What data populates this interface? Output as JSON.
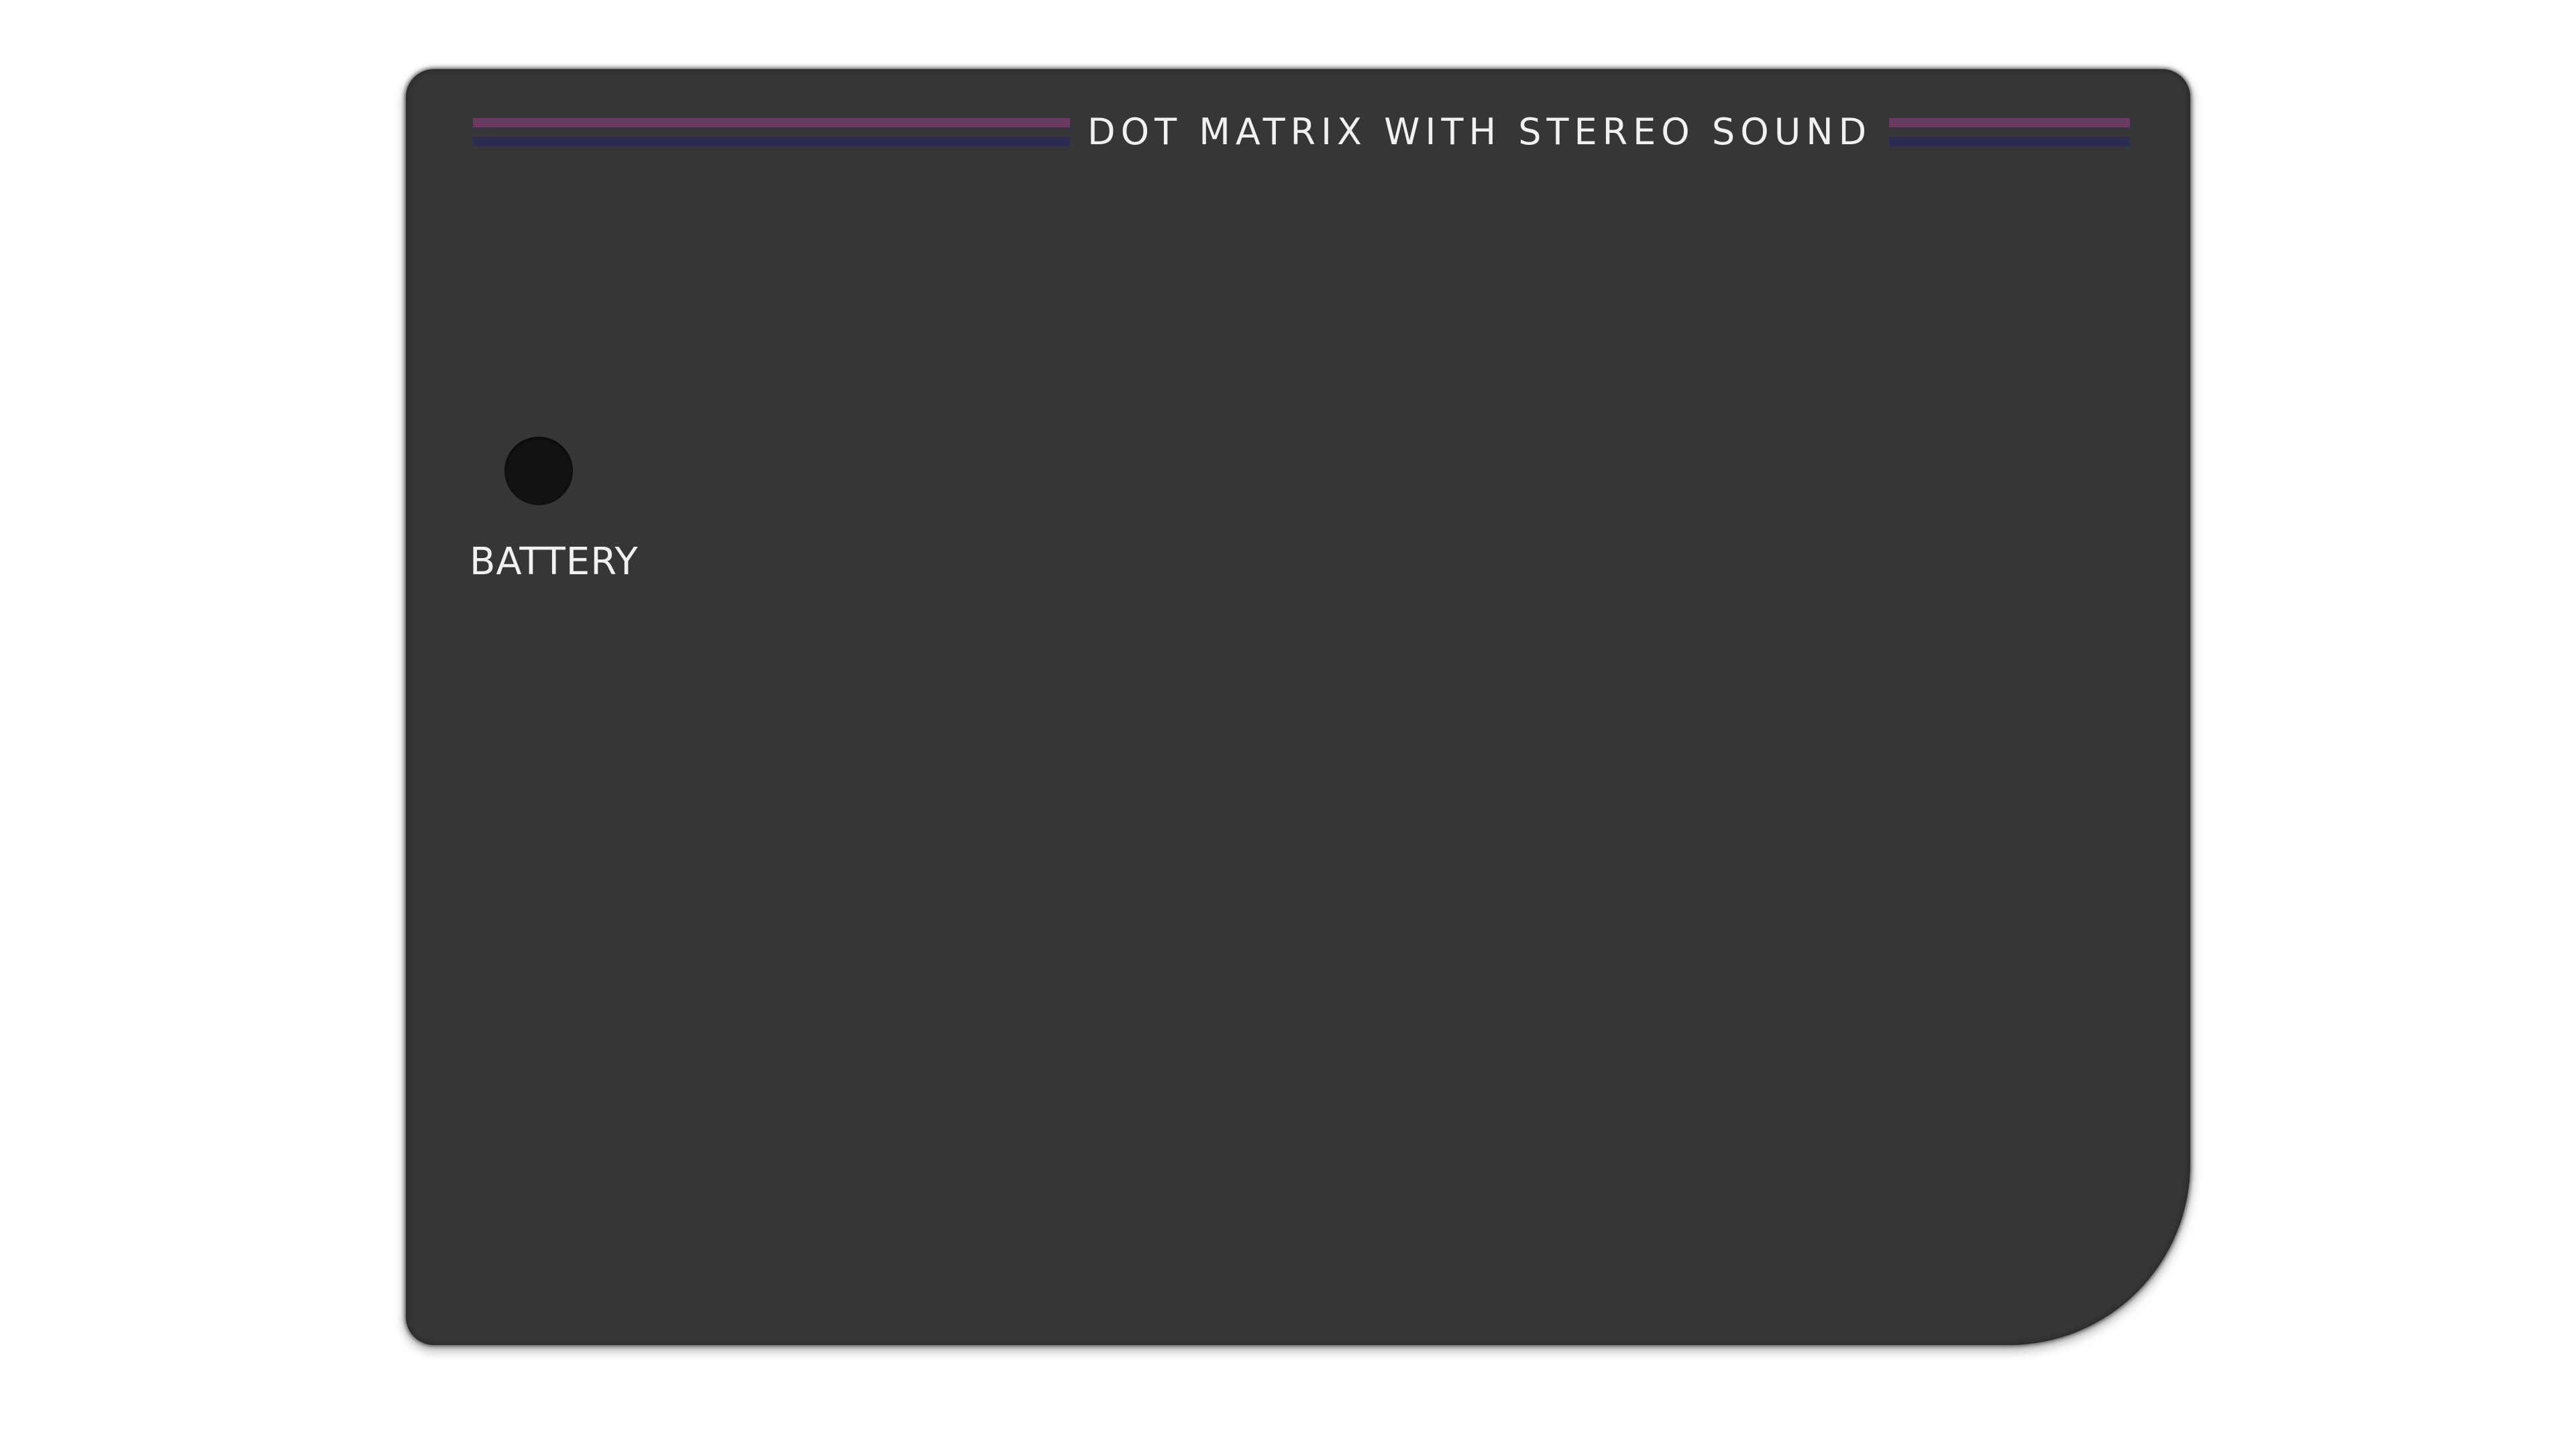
{
  "bezel": {
    "title": "DOT MATRIX WITH STEREO SOUND",
    "battery_label": "BATTERY",
    "colors": {
      "panel": "#363638",
      "stripe_top": "#6b3a63",
      "stripe_bottom": "#2b2c52",
      "battery_led": "#121212",
      "text": "#f1f1f1"
    }
  }
}
